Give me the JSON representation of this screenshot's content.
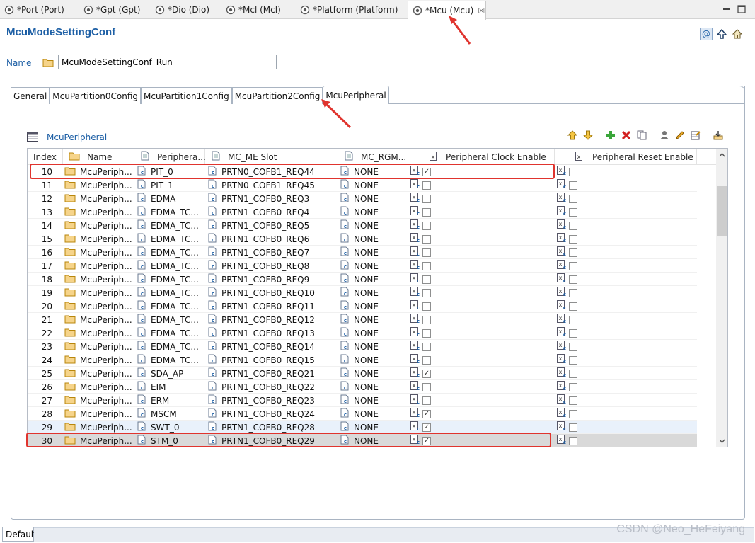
{
  "editor_tabs": [
    {
      "label": "*Port (Port)",
      "active": false
    },
    {
      "label": "*Gpt (Gpt)",
      "active": false
    },
    {
      "label": "*Dio (Dio)",
      "active": false
    },
    {
      "label": "*Mcl (Mcl)",
      "active": false
    },
    {
      "label": "*Platform (Platform)",
      "active": false
    },
    {
      "label": "*Mcu (Mcu)",
      "active": true,
      "close": "☒"
    }
  ],
  "page_title": "McuModeSettingConf",
  "header_icons": [
    "at-icon",
    "up-arrow-icon",
    "home-icon"
  ],
  "name_field": {
    "label": "Name",
    "value": "McuModeSettingConf_Run"
  },
  "config_tabs": [
    {
      "label": "General",
      "active": false
    },
    {
      "label": "McuPartition0Config",
      "active": false
    },
    {
      "label": "McuPartition1Config",
      "active": false
    },
    {
      "label": "McuPartition2Config",
      "active": false
    },
    {
      "label": "McuPeripheral",
      "active": true
    }
  ],
  "section_title": "McuPeripheral",
  "toolbar_icons": [
    "move-up-icon",
    "move-down-icon",
    "add-icon",
    "delete-icon",
    "copy-icon",
    "user-icon",
    "edit-icon",
    "table-edit-icon",
    "import-icon"
  ],
  "table": {
    "headers": {
      "index": "Index",
      "name": "Name",
      "peripheral": "Periphera...",
      "slot": "MC_ME Slot",
      "rgm": "MC_RGM...",
      "clock": "Peripheral Clock Enable",
      "reset": "Peripheral Reset Enable"
    },
    "rows": [
      {
        "index": "10",
        "name": "McuPeriph...",
        "peripheral": "PIT_0",
        "slot": "PRTN0_COFB1_REQ44",
        "rgm": "NONE",
        "clock": true,
        "reset": false
      },
      {
        "index": "11",
        "name": "McuPeriph...",
        "peripheral": "PIT_1",
        "slot": "PRTN0_COFB1_REQ45",
        "rgm": "NONE",
        "clock": false,
        "reset": false
      },
      {
        "index": "12",
        "name": "McuPeriph...",
        "peripheral": "EDMA",
        "slot": "PRTN1_COFB0_REQ3",
        "rgm": "NONE",
        "clock": false,
        "reset": false
      },
      {
        "index": "13",
        "name": "McuPeriph...",
        "peripheral": "EDMA_TC...",
        "slot": "PRTN1_COFB0_REQ4",
        "rgm": "NONE",
        "clock": false,
        "reset": false
      },
      {
        "index": "14",
        "name": "McuPeriph...",
        "peripheral": "EDMA_TC...",
        "slot": "PRTN1_COFB0_REQ5",
        "rgm": "NONE",
        "clock": false,
        "reset": false
      },
      {
        "index": "15",
        "name": "McuPeriph...",
        "peripheral": "EDMA_TC...",
        "slot": "PRTN1_COFB0_REQ6",
        "rgm": "NONE",
        "clock": false,
        "reset": false
      },
      {
        "index": "16",
        "name": "McuPeriph...",
        "peripheral": "EDMA_TC...",
        "slot": "PRTN1_COFB0_REQ7",
        "rgm": "NONE",
        "clock": false,
        "reset": false
      },
      {
        "index": "17",
        "name": "McuPeriph...",
        "peripheral": "EDMA_TC...",
        "slot": "PRTN1_COFB0_REQ8",
        "rgm": "NONE",
        "clock": false,
        "reset": false
      },
      {
        "index": "18",
        "name": "McuPeriph...",
        "peripheral": "EDMA_TC...",
        "slot": "PRTN1_COFB0_REQ9",
        "rgm": "NONE",
        "clock": false,
        "reset": false
      },
      {
        "index": "19",
        "name": "McuPeriph...",
        "peripheral": "EDMA_TC...",
        "slot": "PRTN1_COFB0_REQ10",
        "rgm": "NONE",
        "clock": false,
        "reset": false
      },
      {
        "index": "20",
        "name": "McuPeriph...",
        "peripheral": "EDMA_TC...",
        "slot": "PRTN1_COFB0_REQ11",
        "rgm": "NONE",
        "clock": false,
        "reset": false
      },
      {
        "index": "21",
        "name": "McuPeriph...",
        "peripheral": "EDMA_TC...",
        "slot": "PRTN1_COFB0_REQ12",
        "rgm": "NONE",
        "clock": false,
        "reset": false
      },
      {
        "index": "22",
        "name": "McuPeriph...",
        "peripheral": "EDMA_TC...",
        "slot": "PRTN1_COFB0_REQ13",
        "rgm": "NONE",
        "clock": false,
        "reset": false
      },
      {
        "index": "23",
        "name": "McuPeriph...",
        "peripheral": "EDMA_TC...",
        "slot": "PRTN1_COFB0_REQ14",
        "rgm": "NONE",
        "clock": false,
        "reset": false
      },
      {
        "index": "24",
        "name": "McuPeriph...",
        "peripheral": "EDMA_TC...",
        "slot": "PRTN1_COFB0_REQ15",
        "rgm": "NONE",
        "clock": false,
        "reset": false
      },
      {
        "index": "25",
        "name": "McuPeriph...",
        "peripheral": "SDA_AP",
        "slot": "PRTN1_COFB0_REQ21",
        "rgm": "NONE",
        "clock": true,
        "reset": false
      },
      {
        "index": "26",
        "name": "McuPeriph...",
        "peripheral": "EIM",
        "slot": "PRTN1_COFB0_REQ22",
        "rgm": "NONE",
        "clock": false,
        "reset": false
      },
      {
        "index": "27",
        "name": "McuPeriph...",
        "peripheral": "ERM",
        "slot": "PRTN1_COFB0_REQ23",
        "rgm": "NONE",
        "clock": false,
        "reset": false
      },
      {
        "index": "28",
        "name": "McuPeriph...",
        "peripheral": "MSCM",
        "slot": "PRTN1_COFB0_REQ24",
        "rgm": "NONE",
        "clock": true,
        "reset": false
      },
      {
        "index": "29",
        "name": "McuPeriph...",
        "peripheral": "SWT_0",
        "slot": "PRTN1_COFB0_REQ28",
        "rgm": "NONE",
        "clock": true,
        "reset": false
      },
      {
        "index": "30",
        "name": "McuPeriph...",
        "peripheral": "STM_0",
        "slot": "PRTN1_COFB0_REQ29",
        "rgm": "NONE",
        "clock": true,
        "reset": false
      }
    ]
  },
  "bottom_tab": "Default",
  "watermark": "CSDN @Neo_HeFeiyang",
  "colors": {
    "accent": "#1d5fa5",
    "annotation_red": "#e0342e",
    "selected_row": "#d9d9d9"
  }
}
